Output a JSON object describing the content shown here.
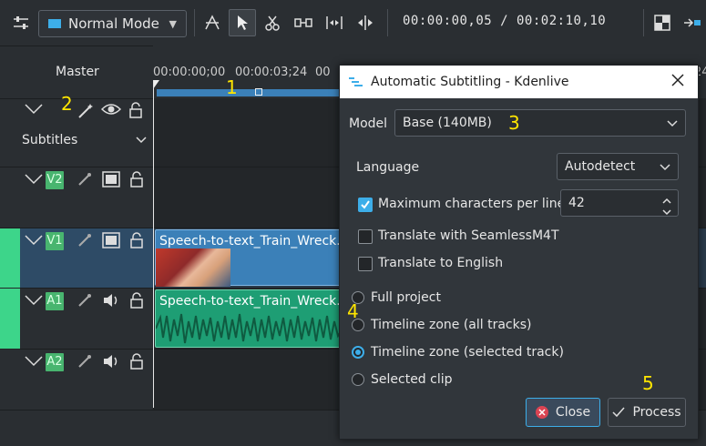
{
  "toolbar": {
    "mode_label": "Normal Mode",
    "timecode": "00:00:00,05 / 00:02:10,10",
    "icons": [
      "settings-sliders-icon",
      "mode-icon",
      "razor-fx-icon",
      "select-tool-icon",
      "cut-tool-icon",
      "spacer-tool-icon",
      "slip-tool-icon",
      "ripple-tool-icon",
      "monitor-icon",
      "extract-icon"
    ]
  },
  "timeline": {
    "master_label": "Master",
    "ruler_ticks": [
      "00:00:00;00",
      "00:00:03;24",
      "00",
      "24"
    ],
    "subtitles_label": "Subtitles",
    "tracks": [
      {
        "name": "V2",
        "type": "video"
      },
      {
        "name": "V1",
        "type": "video"
      },
      {
        "name": "A1",
        "type": "audio"
      },
      {
        "name": "A2",
        "type": "audio"
      }
    ],
    "clips": {
      "video_clip_label": "Speech-to-text_Train_Wreck.m",
      "audio_clip_label": "Speech-to-text_Train_Wreck.m"
    }
  },
  "annotations": {
    "n1": "1",
    "n2": "2",
    "n3": "3",
    "n4": "4",
    "n5": "5"
  },
  "dialog": {
    "title": "Automatic Subtitling - Kdenlive",
    "model_label": "Model",
    "model_value": "Base (140MB)",
    "language_label": "Language",
    "language_value": "Autodetect",
    "max_chars_label": "Maximum characters per line",
    "max_chars_value": "42",
    "max_chars_checked": true,
    "translate_seamless_label": "Translate with SeamlessM4T",
    "translate_english_label": "Translate to English",
    "radio_options": [
      "Full project",
      "Timeline zone (all tracks)",
      "Timeline zone (selected track)",
      "Selected clip"
    ],
    "radio_selected_index": 2,
    "close_label": "Close",
    "process_label": "Process"
  },
  "colors": {
    "accent": "#3daee9",
    "track_green": "#3dd58a",
    "video_clip": "#3b80b8",
    "audio_clip": "#1e9e74",
    "annotation": "#ffe600"
  }
}
